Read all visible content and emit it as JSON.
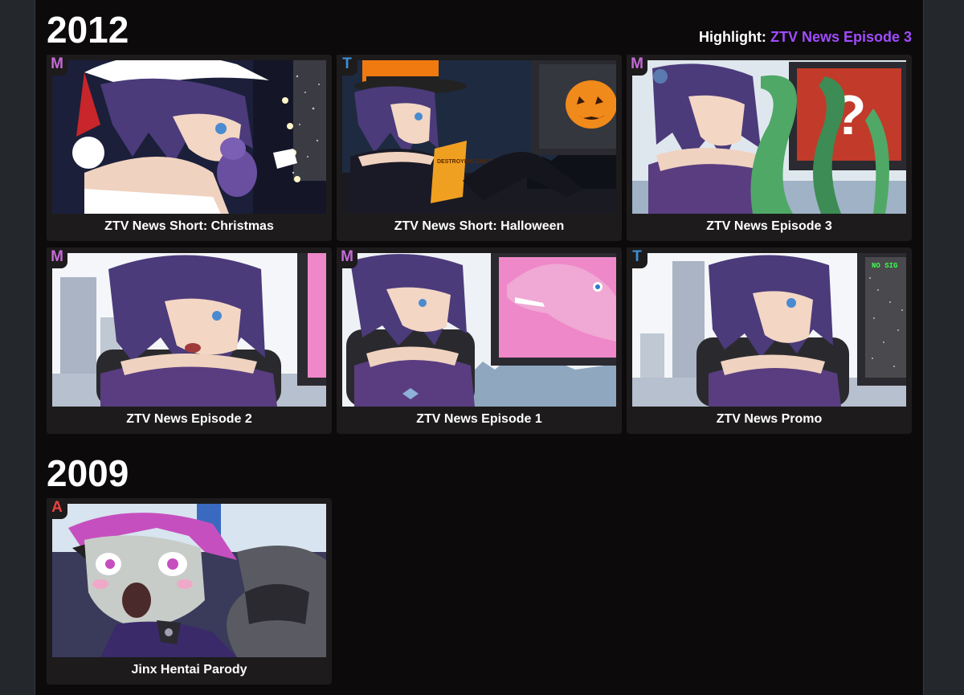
{
  "highlight": {
    "label": "Highlight:",
    "link": "ZTV News Episode 3"
  },
  "sections": [
    {
      "year": "2012",
      "cards": [
        {
          "rating": "M",
          "title": "ZTV News Short: Christmas",
          "scene": "christmas"
        },
        {
          "rating": "T",
          "title": "ZTV News Short: Halloween",
          "scene": "halloween"
        },
        {
          "rating": "M",
          "title": "ZTV News Episode 3",
          "scene": "episode3"
        },
        {
          "rating": "M",
          "title": "ZTV News Episode 2",
          "scene": "episode2"
        },
        {
          "rating": "M",
          "title": "ZTV News Episode 1",
          "scene": "episode1"
        },
        {
          "rating": "T",
          "title": "ZTV News Promo",
          "scene": "promo"
        }
      ]
    },
    {
      "year": "2009",
      "cards": [
        {
          "rating": "A",
          "title": "Jinx Hentai Parody",
          "scene": "jinx"
        }
      ]
    }
  ],
  "thumb_text": {
    "halloween_book": "DESTROYING CHILDHOOD",
    "promo_screen": "NO SIG"
  },
  "colors": {
    "background": "#0c0a0a",
    "card": "#1d1b1c",
    "highlight_link": "#a04cff",
    "rating_M": "#c36ad6",
    "rating_T": "#3c8fd6",
    "rating_A": "#e8433f"
  }
}
